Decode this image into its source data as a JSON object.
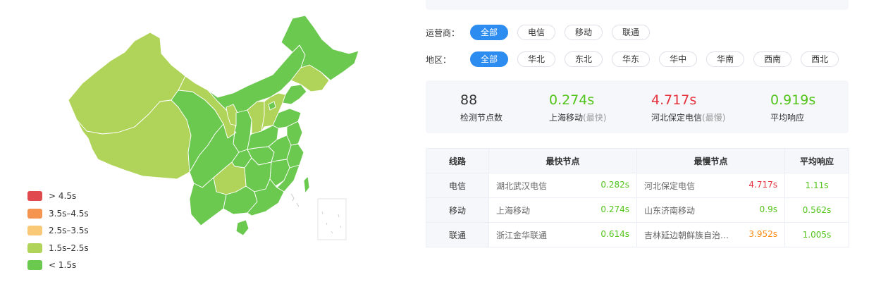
{
  "legend": [
    {
      "label": "> 4.5s",
      "color": "#e04a4f"
    },
    {
      "label": "3.5s–4.5s",
      "color": "#f5944f"
    },
    {
      "label": "2.5s–3.5s",
      "color": "#f9c978"
    },
    {
      "label": "1.5s–2.5s",
      "color": "#b0d45a"
    },
    {
      "label": "< 1.5s",
      "color": "#6bc94f"
    }
  ],
  "map": {
    "fill_fast": "#6bc94f",
    "fill_medium": "#b0d45a",
    "border_color": "#ffffff",
    "medium_regions": [
      "新疆",
      "西藏",
      "甘肃",
      "宁夏",
      "吉林",
      "河北",
      "山西",
      "贵州"
    ]
  },
  "filters": {
    "operator": {
      "label": "运营商：",
      "options": [
        "全部",
        "电信",
        "移动",
        "联通"
      ],
      "selected": "全部"
    },
    "region": {
      "label": "地区：",
      "options": [
        "全部",
        "华北",
        "东北",
        "华东",
        "华中",
        "华南",
        "西南",
        "西北"
      ],
      "selected": "全部"
    }
  },
  "stats": {
    "node_count": {
      "value": "88",
      "label": "检测节点数"
    },
    "fastest": {
      "value": "0.274s",
      "label": "上海移动",
      "note": "(最快)"
    },
    "slowest": {
      "value": "4.717s",
      "label": "河北保定电信",
      "note": "(最慢)"
    },
    "average": {
      "value": "0.919s",
      "label": "平均响应"
    }
  },
  "colors": {
    "green": "#52c41a",
    "red": "#e5323e",
    "orange": "#fa8c16",
    "accent": "#2d8cf0"
  },
  "table": {
    "headers": [
      "线路",
      "最快节点",
      "最慢节点",
      "平均响应"
    ],
    "rows": [
      {
        "line": "电信",
        "fast_node": "湖北武汉电信",
        "fast_time": "0.282s",
        "slow_node": "河北保定电信",
        "slow_time": "4.717s",
        "slow_level": "red",
        "avg": "1.11s"
      },
      {
        "line": "移动",
        "fast_node": "上海移动",
        "fast_time": "0.274s",
        "slow_node": "山东济南移动",
        "slow_time": "0.9s",
        "slow_level": "green",
        "avg": "0.562s"
      },
      {
        "line": "联通",
        "fast_node": "浙江金华联通",
        "fast_time": "0.614s",
        "slow_node": "吉林延边朝鲜族自治…",
        "slow_time": "3.952s",
        "slow_level": "orange",
        "avg": "1.005s"
      }
    ]
  }
}
